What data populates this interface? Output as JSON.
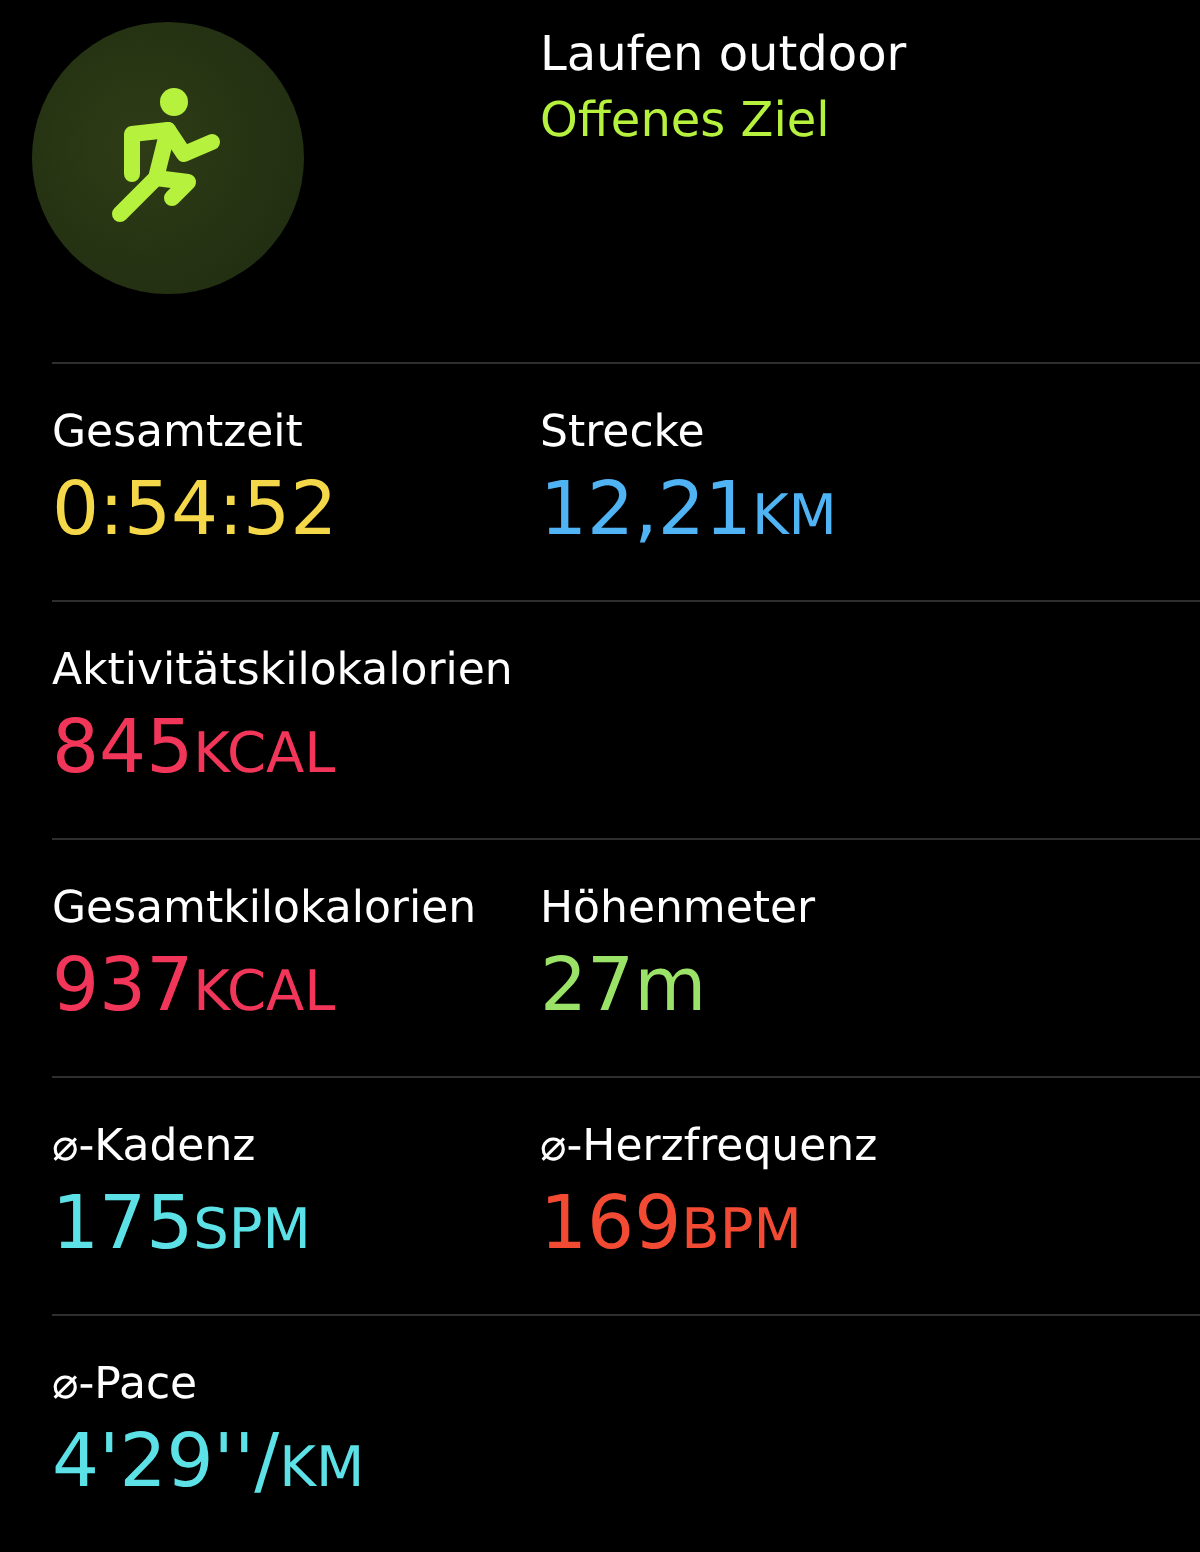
{
  "workout": {
    "title": "Laufen outdoor",
    "goal": "Offenes Ziel"
  },
  "rows": [
    {
      "metrics": [
        {
          "label": "Gesamtzeit",
          "value": "0:54:52",
          "color": "#f5d84a"
        },
        {
          "label": "Strecke",
          "value": "12,21",
          "unit": "KM",
          "color": "#4fb3f4"
        }
      ]
    },
    {
      "metrics": [
        {
          "label": "Aktivitätskilokalorien",
          "value": "845",
          "unit": "KCAL",
          "color": "#f2365a"
        }
      ]
    },
    {
      "metrics": [
        {
          "label": "Gesamtkilokalorien",
          "value": "937",
          "unit": "KCAL",
          "color": "#f2365a"
        },
        {
          "label": "Höhenmeter",
          "value": "27m",
          "color": "#9ae368"
        }
      ]
    },
    {
      "metrics": [
        {
          "label": "⌀-Kadenz",
          "value": "175",
          "unit": "SPM",
          "color": "#5ce1e6"
        },
        {
          "label": "⌀-Herzfrequenz",
          "value": "169",
          "unit": "BPM",
          "color": "#f24a33"
        }
      ]
    },
    {
      "metrics": [
        {
          "label": "⌀-Pace",
          "value": "4'29''/",
          "unit": "KM",
          "color": "#5ce1e6"
        }
      ]
    }
  ]
}
